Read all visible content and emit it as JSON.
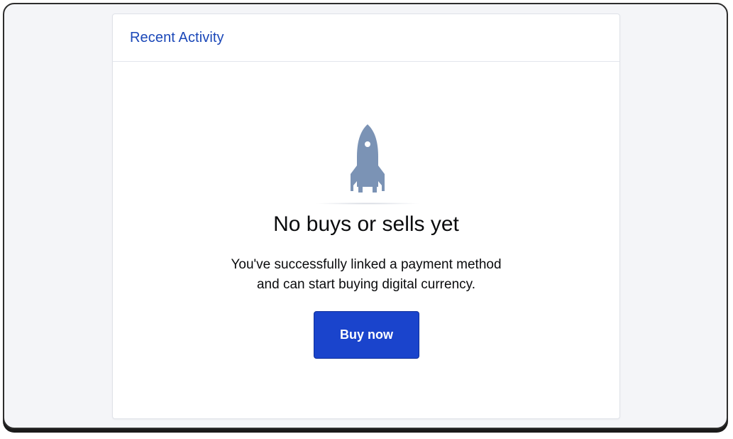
{
  "recent_activity": {
    "title": "Recent Activity",
    "empty_state": {
      "icon": "rocket-icon",
      "heading": "No buys or sells yet",
      "description_line1": "You've successfully linked a payment method",
      "description_line2": "and can start buying digital currency.",
      "button_label": "Buy now"
    }
  },
  "colors": {
    "accent": "#1a44cc",
    "title": "#1a47b8",
    "icon": "#7b93b5"
  }
}
